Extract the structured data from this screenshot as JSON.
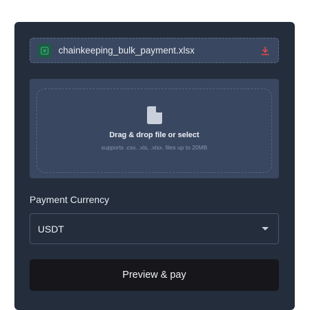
{
  "file": {
    "name": "chainkeeping_bulk_payment.xlsx",
    "icon": "excel-file-icon",
    "action_icon": "download-icon",
    "action_color": "#e5484d"
  },
  "dropzone": {
    "icon": "document-icon",
    "title": "Drag & drop file or select",
    "subtitle": "supports .csv, .xls, .xlsx. files up to 20MB"
  },
  "currency": {
    "label": "Payment Currency",
    "selected": "USDT"
  },
  "submit": {
    "label": "Preview & pay"
  },
  "colors": {
    "panel": "#232d3c",
    "field": "#3a4760",
    "button": "#16161b",
    "excel_green": "#2fb36f"
  }
}
